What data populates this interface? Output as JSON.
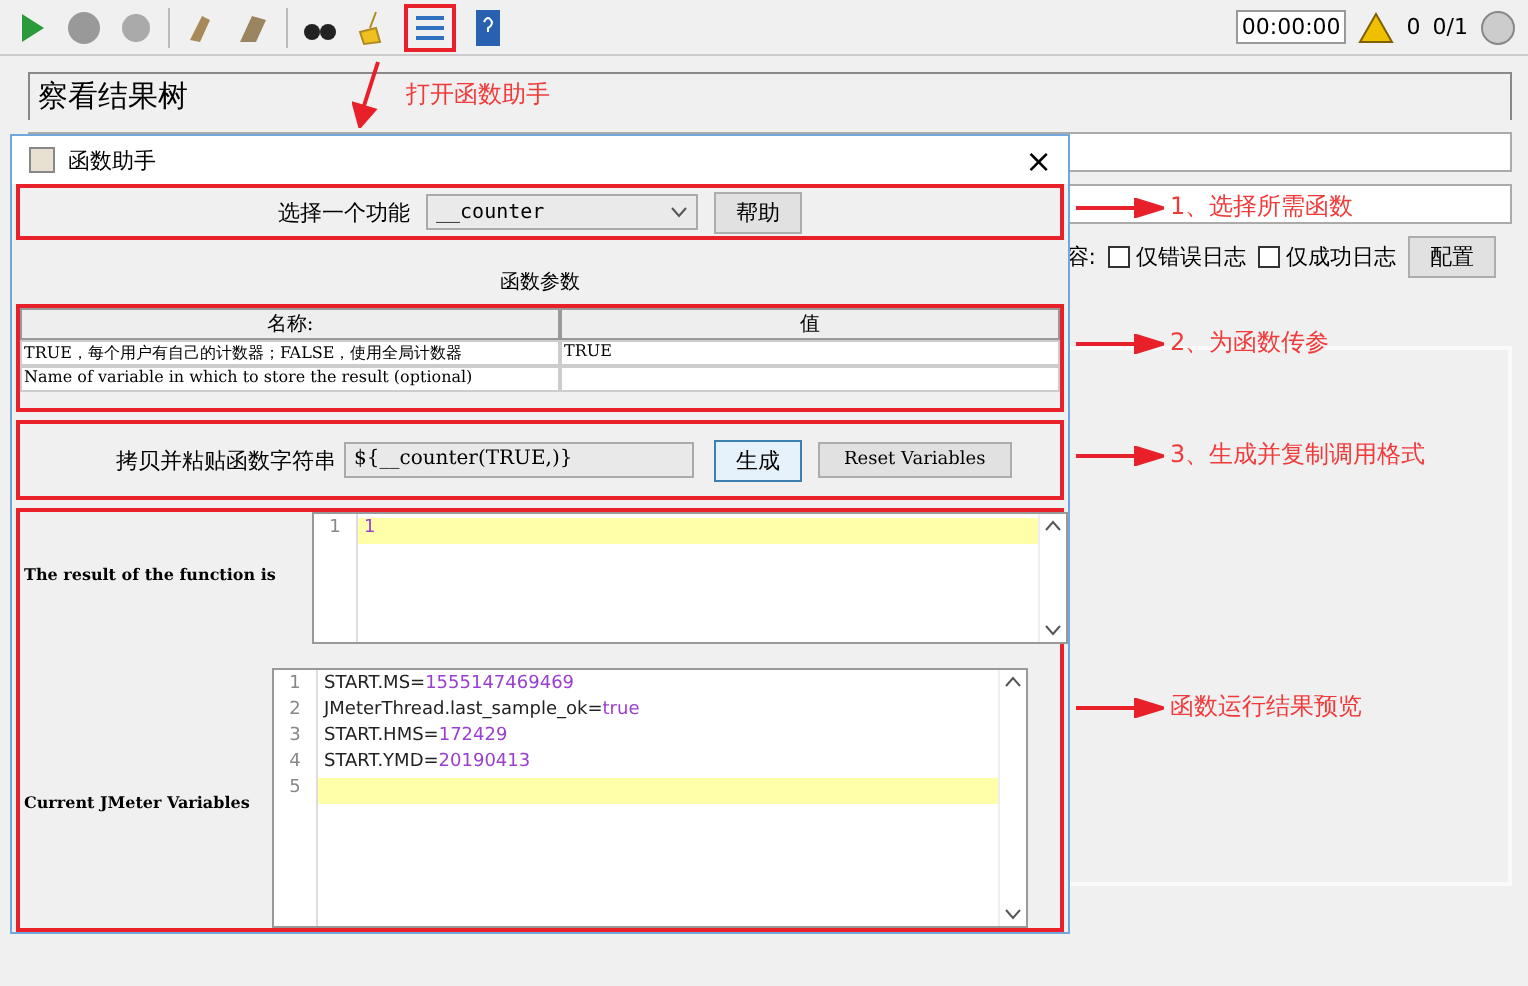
{
  "toolbar": {
    "timer": "00:00:00",
    "warnings": "0",
    "threads": "0/1"
  },
  "background": {
    "panel_title": "察看结果树",
    "options_label": "容:",
    "checkboxes": [
      {
        "label": "仅错误日志",
        "checked": false
      },
      {
        "label": "仅成功日志",
        "checked": false
      }
    ],
    "config_button": "配置"
  },
  "dialog": {
    "title": "函数助手",
    "close": "×",
    "function_label": "选择一个功能",
    "function_value": "__counter",
    "help_button": "帮助",
    "params_title": "函数参数",
    "params_columns": [
      "名称:",
      "值"
    ],
    "params_rows": [
      {
        "name": "TRUE，每个用户有自己的计数器；FALSE，使用全局计数器",
        "value": "TRUE"
      },
      {
        "name": "Name of variable in which to store the result (optional)"
      }
    ],
    "copy_label": "拷贝并粘贴函数字符串",
    "copy_value": "${__counter(TRUE,)}",
    "generate_button": "生成",
    "reset_button": "Reset Variables",
    "result_label": "The result of the function is",
    "result_lines": [
      {
        "number": "1",
        "value": "1",
        "current": true
      }
    ],
    "variables_label": "Current JMeter Variables",
    "variables_lines": [
      {
        "number": "1",
        "key": "START.MS=",
        "value": "1555147469469",
        "current": false
      },
      {
        "number": "2",
        "key": "JMeterThread.last_sample_ok=",
        "value": "true",
        "current": false
      },
      {
        "number": "3",
        "key": "START.HMS=",
        "value": "172429",
        "current": false
      },
      {
        "number": "4",
        "key": "START.YMD=",
        "value": "20190413",
        "current": false
      },
      {
        "number": "5",
        "current": true
      }
    ]
  },
  "annotations": {
    "toolbar_note": "打开函数助手",
    "steps": [
      "1、选择所需函数",
      "2、为函数传参",
      "3、生成并复制调用格式",
      "函数运行结果预览"
    ]
  }
}
